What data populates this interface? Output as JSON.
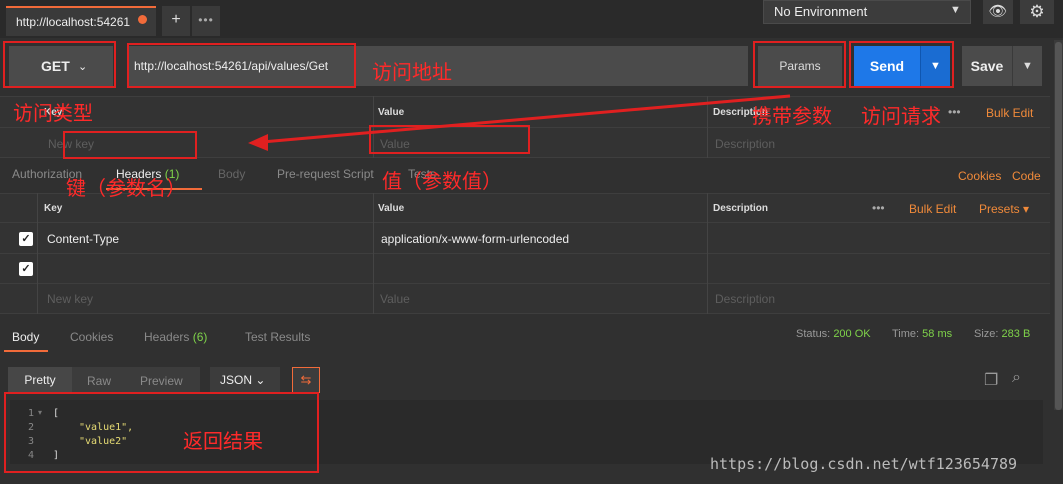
{
  "tabs": {
    "active_label": "http://localhost:54261",
    "plus": "+",
    "more": "•••"
  },
  "environment": {
    "selected": "No Environment"
  },
  "request": {
    "method": "GET",
    "url": "http://localhost:54261/api/values/Get",
    "params_label": "Params",
    "send_label": "Send",
    "save_label": "Save"
  },
  "params_table": {
    "col_key": "Key",
    "col_value": "Value",
    "col_description": "Description",
    "more": "•••",
    "bulk_edit": "Bulk Edit",
    "ph_key": "New key",
    "ph_value": "Value",
    "ph_description": "Description"
  },
  "request_tabs": {
    "authorization": "Authorization",
    "headers": "Headers",
    "headers_count": "(1)",
    "body": "Body",
    "prerequest": "Pre-request Script",
    "tests": "Tests",
    "cookies": "Cookies",
    "code": "Code"
  },
  "headers_table": {
    "col_key": "Key",
    "col_value": "Value",
    "col_description": "Description",
    "more": "•••",
    "bulk_edit": "Bulk Edit",
    "presets": "Presets",
    "rows": [
      {
        "key": "Content-Type",
        "value": "application/x-www-form-urlencoded"
      }
    ],
    "ph_key": "New key",
    "ph_value": "Value",
    "ph_description": "Description"
  },
  "response_tabs": {
    "body": "Body",
    "cookies": "Cookies",
    "headers": "Headers",
    "headers_count": "(6)",
    "test_results": "Test Results",
    "status_label": "Status:",
    "status_value": "200 OK",
    "time_label": "Time:",
    "time_value": "58 ms",
    "size_label": "Size:",
    "size_value": "283 B"
  },
  "view": {
    "pretty": "Pretty",
    "raw": "Raw",
    "preview": "Preview",
    "format": "JSON"
  },
  "code": {
    "lines": [
      "1",
      "2",
      "3",
      "4"
    ],
    "open": "[",
    "val1": "\"value1\",",
    "val2": "\"value2\"",
    "close": "]"
  },
  "annotations": {
    "url": "访问地址",
    "method": "访问类型",
    "params": "携带参数",
    "send": "访问请求",
    "key": "键（参数名）",
    "value": "值（参数值）",
    "result": "返回结果"
  },
  "watermark": "https://blog.csdn.net/wtf123654789",
  "colors": {
    "accent": "#f26b3a",
    "send": "#1e78e8",
    "annotation": "#e02020",
    "success": "#7fd34a"
  }
}
